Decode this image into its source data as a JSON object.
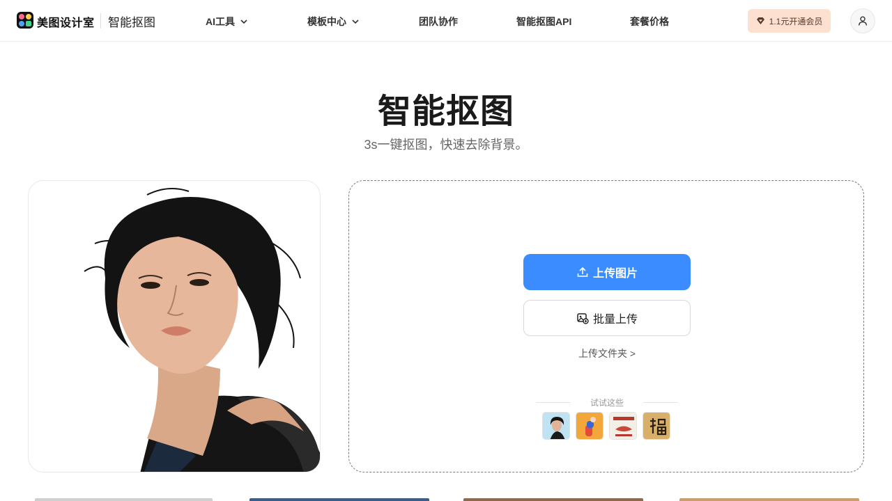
{
  "header": {
    "brand": "美图设计室",
    "product": "智能抠图",
    "nav": [
      {
        "label": "AI工具",
        "has_dropdown": true
      },
      {
        "label": "模板中心",
        "has_dropdown": true
      },
      {
        "label": "团队协作",
        "has_dropdown": false
      },
      {
        "label": "智能抠图API",
        "has_dropdown": false
      },
      {
        "label": "套餐价格",
        "has_dropdown": false
      }
    ],
    "vip_label": "1.1元开通会员",
    "icons": {
      "vip": "diamond-icon",
      "account": "user-icon",
      "dropdown": "chevron-down-icon"
    }
  },
  "hero": {
    "title": "智能抠图",
    "subtitle": "3s一键抠图，快速去除背景。"
  },
  "upload": {
    "upload_label": "上传图片",
    "batch_label": "批量上传",
    "folder_label": "上传文件夹 >",
    "try_label": "试试这些",
    "icons": {
      "upload": "upload-icon",
      "batch": "batch-images-icon"
    }
  },
  "colors": {
    "primary": "#3a8cff",
    "vip_bg": "#fde0cf",
    "border": "#e8e8e8"
  }
}
